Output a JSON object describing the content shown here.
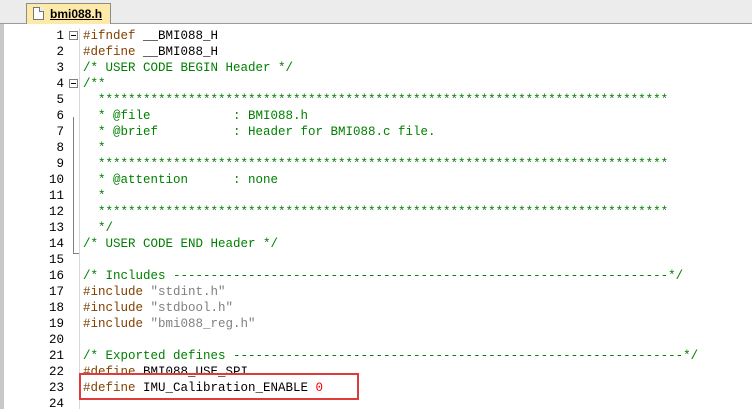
{
  "tab": {
    "label": "bmi088.h",
    "icon": "file-icon"
  },
  "editor": {
    "lines": [
      {
        "n": "1",
        "fold": true,
        "parts": [
          {
            "c": "pp",
            "t": "#ifndef "
          },
          {
            "c": "",
            "t": "__BMI088_H"
          }
        ]
      },
      {
        "n": "2",
        "parts": [
          {
            "c": "pp",
            "t": "#define "
          },
          {
            "c": "",
            "t": "__BMI088_H"
          }
        ]
      },
      {
        "n": "3",
        "parts": [
          {
            "c": "cm",
            "t": "/* USER CODE BEGIN Header */"
          }
        ]
      },
      {
        "n": "4",
        "fold": true,
        "parts": [
          {
            "c": "cm",
            "t": "/**"
          }
        ]
      },
      {
        "n": "5",
        "parts": [
          {
            "c": "cm",
            "t": "  ****************************************************************************"
          }
        ]
      },
      {
        "n": "6",
        "parts": [
          {
            "c": "cm",
            "t": "  * @file           : BMI088.h"
          }
        ]
      },
      {
        "n": "7",
        "parts": [
          {
            "c": "cm",
            "t": "  * @brief          : Header for BMI088.c file."
          }
        ]
      },
      {
        "n": "8",
        "parts": [
          {
            "c": "cm",
            "t": "  *"
          }
        ]
      },
      {
        "n": "9",
        "parts": [
          {
            "c": "cm",
            "t": "  ****************************************************************************"
          }
        ]
      },
      {
        "n": "10",
        "parts": [
          {
            "c": "cm",
            "t": "  * @attention      : none"
          }
        ]
      },
      {
        "n": "11",
        "parts": [
          {
            "c": "cm",
            "t": "  *"
          }
        ]
      },
      {
        "n": "12",
        "parts": [
          {
            "c": "cm",
            "t": "  ****************************************************************************"
          }
        ]
      },
      {
        "n": "13",
        "parts": [
          {
            "c": "cm",
            "t": "  */"
          }
        ]
      },
      {
        "n": "14",
        "parts": [
          {
            "c": "cm",
            "t": "/* USER CODE END Header */"
          }
        ]
      },
      {
        "n": "15",
        "parts": []
      },
      {
        "n": "16",
        "parts": [
          {
            "c": "cm",
            "t": "/* Includes ------------------------------------------------------------------*/"
          }
        ]
      },
      {
        "n": "17",
        "parts": [
          {
            "c": "pp",
            "t": "#include "
          },
          {
            "c": "st",
            "t": "\"stdint.h\""
          }
        ]
      },
      {
        "n": "18",
        "parts": [
          {
            "c": "pp",
            "t": "#include "
          },
          {
            "c": "st",
            "t": "\"stdbool.h\""
          }
        ]
      },
      {
        "n": "19",
        "parts": [
          {
            "c": "pp",
            "t": "#include "
          },
          {
            "c": "st",
            "t": "\"bmi088_reg.h\""
          }
        ]
      },
      {
        "n": "20",
        "parts": []
      },
      {
        "n": "21",
        "parts": [
          {
            "c": "cm",
            "t": "/* Exported defines ------------------------------------------------------------*/"
          }
        ]
      },
      {
        "n": "22",
        "parts": [
          {
            "c": "pp",
            "t": "#define "
          },
          {
            "c": "",
            "t": "BMI088_USE_SPI"
          }
        ]
      },
      {
        "n": "23",
        "parts": [
          {
            "c": "pp",
            "t": "#define "
          },
          {
            "c": "",
            "t": "IMU_Calibration_ENABLE "
          },
          {
            "c": "num",
            "t": "0"
          }
        ]
      },
      {
        "n": "24",
        "parts": []
      }
    ]
  },
  "colors": {
    "preprocessor": "#804000",
    "comment": "#008000",
    "string": "#808080",
    "number": "#ff0000",
    "highlight_box": "#e03b3b",
    "tab_active": "#fde9a8"
  }
}
